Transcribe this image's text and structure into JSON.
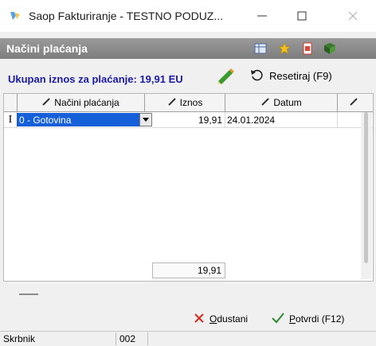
{
  "window": {
    "title": "Saop Fakturiranje - TESTNO PODUZ..."
  },
  "header": {
    "title": "Načini plaćanja",
    "icons": [
      "grid-settings-icon",
      "star-icon",
      "document-icon",
      "book-icon"
    ]
  },
  "total": {
    "label": "Ukupan iznos za plaćanje: 19,91 EU"
  },
  "reset_button": {
    "label": "Resetiraj (F9)"
  },
  "grid": {
    "columns": [
      "Načini plaćanja",
      "Iznos",
      "Datum",
      ""
    ],
    "rows": [
      {
        "indicator": "I",
        "method": "0 - Gotovina",
        "amount": "19,91",
        "date": "24.01.2024"
      }
    ],
    "sum": "19,91"
  },
  "buttons": {
    "cancel_prefix": "O",
    "cancel_rest": "dustani",
    "confirm_prefix": "P",
    "confirm_rest": "otvrdi (F12)"
  },
  "status": {
    "user": "Skrbnik",
    "code": "002"
  },
  "colors": {
    "accent_blue": "#1a1aa6",
    "selection": "#1560d8",
    "header_gray": "#8a8a8a"
  }
}
